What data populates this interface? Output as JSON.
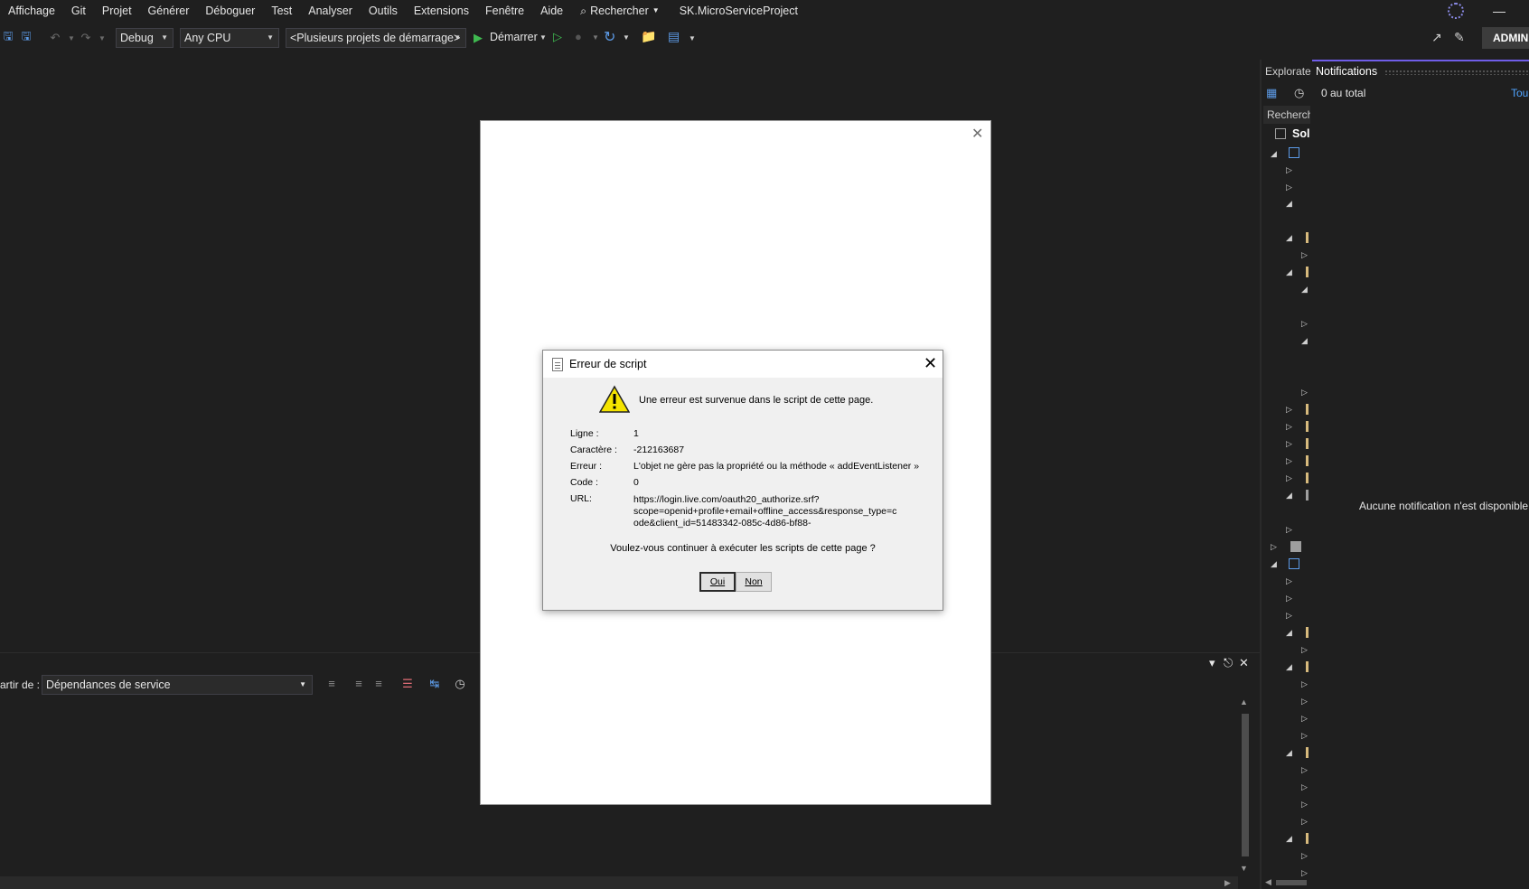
{
  "menu": {
    "items": [
      "Affichage",
      "Git",
      "Projet",
      "Générer",
      "Déboguer",
      "Test",
      "Analyser",
      "Outils",
      "Extensions",
      "Fenêtre",
      "Aide"
    ],
    "search_label": "Rechercher",
    "project_name": "SK.MicroServiceProject"
  },
  "toolbar": {
    "config": "Debug",
    "platform": "Any CPU",
    "startup": "<Plusieurs projets de démarrage>",
    "start_label": "Démarrer",
    "account": "ADMIN"
  },
  "right_panel": {
    "explorer_tab": "Explorate",
    "notifications_tab": "Notifications",
    "total": "0 au total",
    "all_link": "Tou",
    "empty_message": "Aucune notification n'est disponible",
    "explorer_search": "Recherch",
    "solution_label": "Sol"
  },
  "bottom_panel": {
    "label": "artir de :",
    "source": "Dépendances de service"
  },
  "dialog": {
    "title": "Erreur de script",
    "message": "Une erreur est survenue dans le script de cette page.",
    "fields": [
      {
        "key": "Ligne :",
        "value": "1"
      },
      {
        "key": "Caractère :",
        "value": "-212163687"
      },
      {
        "key": "Erreur :",
        "value": "L'objet ne gère pas la propriété ou la méthode « addEventListener »"
      },
      {
        "key": "Code :",
        "value": "0"
      },
      {
        "key": "URL:",
        "value": "https://login.live.com/oauth20_authorize.srf?scope=openid+profile+email+offline_access&response_type=code&client_id=51483342-085c-4d86-bf88-"
      }
    ],
    "url_lines": [
      "https://login.live.com/oauth20_authorize.srf?",
      "scope=openid+profile+email+offline_access&response_type=c",
      "ode&client_id=51483342-085c-4d86-bf88-"
    ],
    "question": "Voulez-vous continuer à exécuter les scripts de cette page ?",
    "yes": "Oui",
    "no": "Non"
  },
  "colors": {
    "background": "#1f1f1f",
    "accent": "#6f5de8",
    "link": "#4fa3ff",
    "run_green": "#3fb950"
  }
}
